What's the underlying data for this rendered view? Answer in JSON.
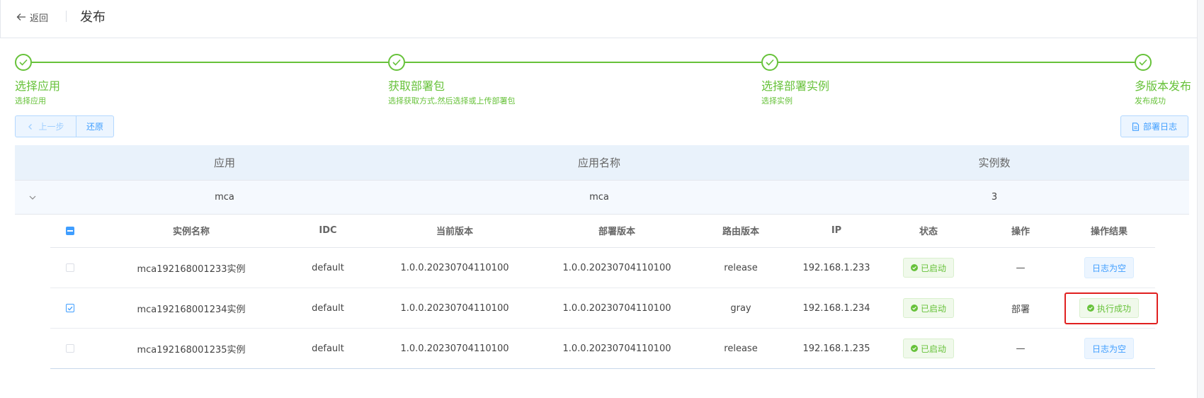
{
  "header": {
    "back_label": "返回",
    "title": "发布"
  },
  "steps": [
    {
      "title": "选择应用",
      "desc": "选择应用"
    },
    {
      "title": "获取部署包",
      "desc": "选择获取方式,然后选择或上传部署包"
    },
    {
      "title": "选择部署实例",
      "desc": "选择实例"
    },
    {
      "title": "多版本发布",
      "desc": "发布成功"
    }
  ],
  "buttons": {
    "prev": "上一步",
    "restore": "还原",
    "log": "部署日志"
  },
  "main_table": {
    "headers": {
      "app": "应用",
      "app_name": "应用名称",
      "instance_count": "实例数"
    },
    "row": {
      "app": "mca",
      "app_name": "mca",
      "instance_count": "3"
    }
  },
  "sub_table": {
    "headers": {
      "instance_name": "实例名称",
      "idc": "IDC",
      "current_version": "当前版本",
      "deploy_version": "部署版本",
      "route_version": "路由版本",
      "ip": "IP",
      "status": "状态",
      "operation": "操作",
      "result": "操作结果"
    },
    "rows": [
      {
        "checked": false,
        "instance_name": "mca192168001233实例",
        "idc": "default",
        "current_version": "1.0.0.20230704110100",
        "deploy_version": "1.0.0.20230704110100",
        "route_version": "release",
        "ip": "192.168.1.233",
        "status": "已启动",
        "operation": "—",
        "result": "日志为空"
      },
      {
        "checked": true,
        "instance_name": "mca192168001234实例",
        "idc": "default",
        "current_version": "1.0.0.20230704110100",
        "deploy_version": "1.0.0.20230704110100",
        "route_version": "gray",
        "ip": "192.168.1.234",
        "status": "已启动",
        "operation": "部署",
        "result": "执行成功"
      },
      {
        "checked": false,
        "instance_name": "mca192168001235实例",
        "idc": "default",
        "current_version": "1.0.0.20230704110100",
        "deploy_version": "1.0.0.20230704110100",
        "route_version": "release",
        "ip": "192.168.1.235",
        "status": "已启动",
        "operation": "—",
        "result": "日志为空"
      }
    ]
  },
  "colors": {
    "success": "#67c23a",
    "primary": "#409eff",
    "highlight": "#e02020"
  }
}
